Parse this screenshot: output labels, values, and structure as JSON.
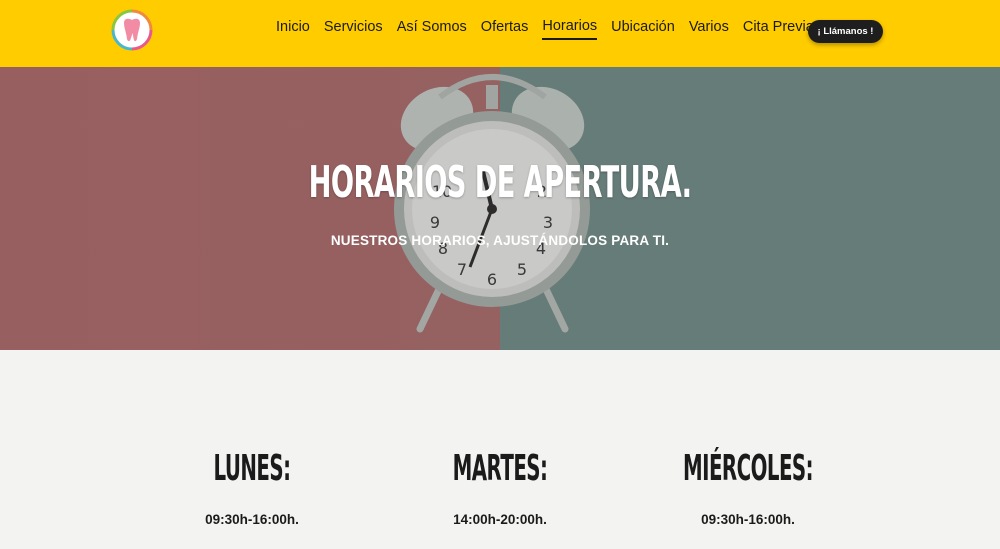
{
  "header": {
    "logo_icon": "tooth-logo-icon",
    "nav": [
      {
        "label": "Inicio",
        "active": false
      },
      {
        "label": "Servicios",
        "active": false
      },
      {
        "label": "Así Somos",
        "active": false
      },
      {
        "label": "Ofertas",
        "active": false
      },
      {
        "label": "Horarios",
        "active": true
      },
      {
        "label": "Ubicación",
        "active": false
      },
      {
        "label": "Varios",
        "active": false
      },
      {
        "label": "Cita Previa",
        "active": false
      }
    ],
    "call_button": "¡ Llámanos !"
  },
  "hero": {
    "title": "HORARIOS DE APERTURA.",
    "subtitle": "NUESTROS HORARIOS, AJUSTÁNDOLOS PARA TI."
  },
  "schedule": [
    {
      "day": "LUNES:",
      "hours": "09:30h-16:00h."
    },
    {
      "day": "MARTES:",
      "hours": "14:00h-20:00h."
    },
    {
      "day": "MIÉRCOLES:",
      "hours": "09:30h-16:00h."
    }
  ],
  "colors": {
    "header_bg": "#ffcc00",
    "button_bg": "#1e1e1e",
    "page_bg": "#f3f3f1",
    "hero_left": "#ad6a6b",
    "hero_right": "#6f8d88"
  }
}
